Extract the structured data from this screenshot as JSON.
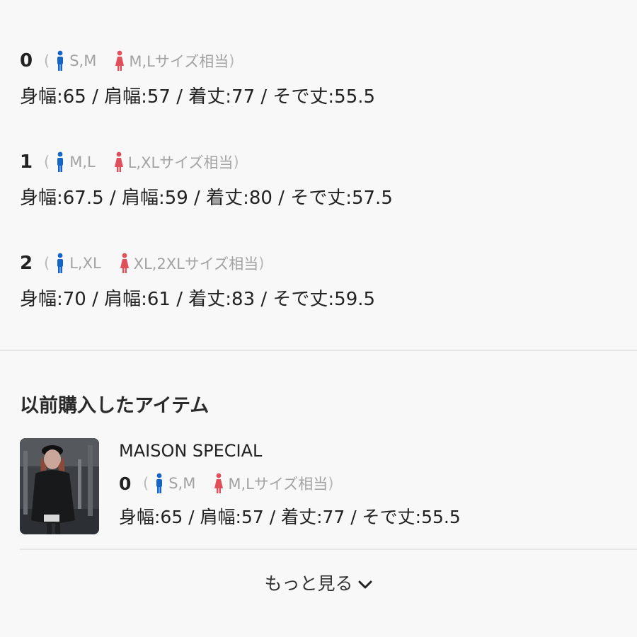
{
  "sizes": [
    {
      "number": "0",
      "open_paren": "(",
      "male_sizes": "S,M",
      "female_sizes": "M,Lサイズ相当",
      "close_paren": ")",
      "measurements": "身幅:65 / 肩幅:57 / 着丈:77 / そで丈:55.5"
    },
    {
      "number": "1",
      "open_paren": "(",
      "male_sizes": "M,L",
      "female_sizes": "L,XLサイズ相当",
      "close_paren": ")",
      "measurements": "身幅:67.5 / 肩幅:59 / 着丈:80 / そで丈:57.5"
    },
    {
      "number": "2",
      "open_paren": "(",
      "male_sizes": "L,XL",
      "female_sizes": "XL,2XLサイズ相当",
      "close_paren": ")",
      "measurements": "身幅:70 / 肩幅:61 / 着丈:83 / そで丈:59.5"
    }
  ],
  "purchased": {
    "title": "以前購入したアイテム",
    "item": {
      "brand": "MAISON SPECIAL",
      "number": "0",
      "open_paren": "(",
      "male_sizes": "S,M",
      "female_sizes": "M,Lサイズ相当",
      "close_paren": ")",
      "measurements": "身幅:65 / 肩幅:57 / 着丈:77 / そで丈:55.5"
    }
  },
  "more_label": "もっと見る",
  "icons": {
    "male": "male-figure-icon",
    "female": "female-figure-icon",
    "chevron": "chevron-down-icon"
  },
  "colors": {
    "male_icon": "#1565c8",
    "female_icon": "#e0505a"
  }
}
